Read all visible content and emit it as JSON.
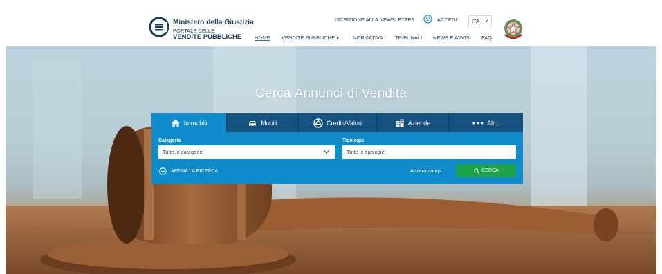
{
  "header": {
    "brand_top": "Ministero della Giustizia",
    "brand_mid": "PORTALE DELLE",
    "brand_bot": "VENDITE PUBBLICHE",
    "newsletter": "ISCRIZIONE ALLA NEWSLETTER",
    "login": "ACCEDI",
    "lang": "ITA",
    "nav": {
      "home": "HOME",
      "vendite": "VENDITE PUBBLICHE ▾",
      "normativa": "NORMATIVA",
      "tribunali": "TRIBUNALI",
      "news": "NEWS E AVVISI",
      "faq": "FAQ"
    },
    "brand_color": "#1c3a5c"
  },
  "hero": {
    "title": "Cerca Annunci di Vendita"
  },
  "search": {
    "tabs": [
      {
        "label": "Immobili",
        "icon": "house-icon",
        "active": true
      },
      {
        "label": "Mobili",
        "icon": "car-icon",
        "active": false
      },
      {
        "label": "Crediti/Valori",
        "icon": "coins-icon",
        "active": false
      },
      {
        "label": "Aziende",
        "icon": "building-icon",
        "active": false
      },
      {
        "label": "Altro",
        "icon": "dots-icon",
        "active": false
      }
    ],
    "category_label": "Categoria",
    "category_value": "Tutte le categorie",
    "type_label": "Tipologia",
    "type_value": "Tutte le tipologie",
    "refine": "AFFINA LA RICERCA",
    "reset": "Azzera campi",
    "submit": "CERCA",
    "colors": {
      "tabs": "#15527f",
      "active": "#0e8ccb",
      "submit": "#1fa34a"
    }
  }
}
